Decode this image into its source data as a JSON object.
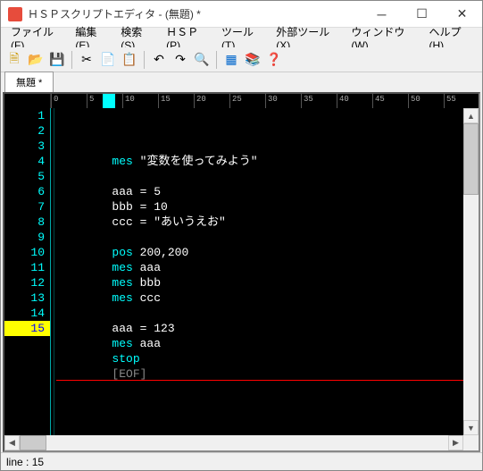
{
  "window": {
    "title": "ＨＳＰスクリプトエディタ - (無題) *"
  },
  "menu": {
    "file": "ファイル(F)",
    "edit": "編集(E)",
    "search": "検索(S)",
    "hsp": "ＨＳＰ(P)",
    "tool": "ツール(T)",
    "ext_tool": "外部ツール(X)",
    "window": "ウィンドウ(W)",
    "help": "ヘルプ(H)"
  },
  "tab": {
    "label": "無題 *"
  },
  "ruler": {
    "marks": [
      "0",
      "5",
      "10",
      "15",
      "20",
      "25",
      "30",
      "35",
      "40",
      "45",
      "50",
      "55"
    ]
  },
  "code": {
    "lines": [
      {
        "n": "1",
        "tokens": [
          [
            "ind",
            "        "
          ],
          [
            "kw",
            "mes"
          ],
          [
            "txt",
            " "
          ],
          [
            "str",
            "\"変数を使ってみよう\""
          ]
        ]
      },
      {
        "n": "2",
        "tokens": []
      },
      {
        "n": "3",
        "tokens": [
          [
            "ind",
            "        "
          ],
          [
            "txt",
            "aaa = "
          ],
          [
            "num",
            "5"
          ]
        ]
      },
      {
        "n": "4",
        "tokens": [
          [
            "ind",
            "        "
          ],
          [
            "txt",
            "bbb = "
          ],
          [
            "num",
            "10"
          ]
        ]
      },
      {
        "n": "5",
        "tokens": [
          [
            "ind",
            "        "
          ],
          [
            "txt",
            "ccc = "
          ],
          [
            "str",
            "\"あいうえお\""
          ]
        ]
      },
      {
        "n": "6",
        "tokens": []
      },
      {
        "n": "7",
        "tokens": [
          [
            "ind",
            "        "
          ],
          [
            "kw",
            "pos"
          ],
          [
            "txt",
            " "
          ],
          [
            "num",
            "200"
          ],
          [
            "txt",
            ","
          ],
          [
            "num",
            "200"
          ]
        ]
      },
      {
        "n": "8",
        "tokens": [
          [
            "ind",
            "        "
          ],
          [
            "kw",
            "mes"
          ],
          [
            "txt",
            " aaa"
          ]
        ]
      },
      {
        "n": "9",
        "tokens": [
          [
            "ind",
            "        "
          ],
          [
            "kw",
            "mes"
          ],
          [
            "txt",
            " bbb"
          ]
        ]
      },
      {
        "n": "10",
        "tokens": [
          [
            "ind",
            "        "
          ],
          [
            "kw",
            "mes"
          ],
          [
            "txt",
            " ccc"
          ]
        ]
      },
      {
        "n": "11",
        "tokens": []
      },
      {
        "n": "12",
        "tokens": [
          [
            "ind",
            "        "
          ],
          [
            "txt",
            "aaa = "
          ],
          [
            "num",
            "123"
          ]
        ]
      },
      {
        "n": "13",
        "tokens": [
          [
            "ind",
            "        "
          ],
          [
            "kw",
            "mes"
          ],
          [
            "txt",
            " aaa"
          ]
        ]
      },
      {
        "n": "14",
        "tokens": [
          [
            "ind",
            "        "
          ],
          [
            "kw",
            "stop"
          ]
        ]
      },
      {
        "n": "15",
        "tokens": [
          [
            "ind",
            "        "
          ],
          [
            "eof",
            "[EOF]"
          ]
        ],
        "active": true
      }
    ]
  },
  "status": {
    "line_label": "line :",
    "line_no": "15"
  }
}
